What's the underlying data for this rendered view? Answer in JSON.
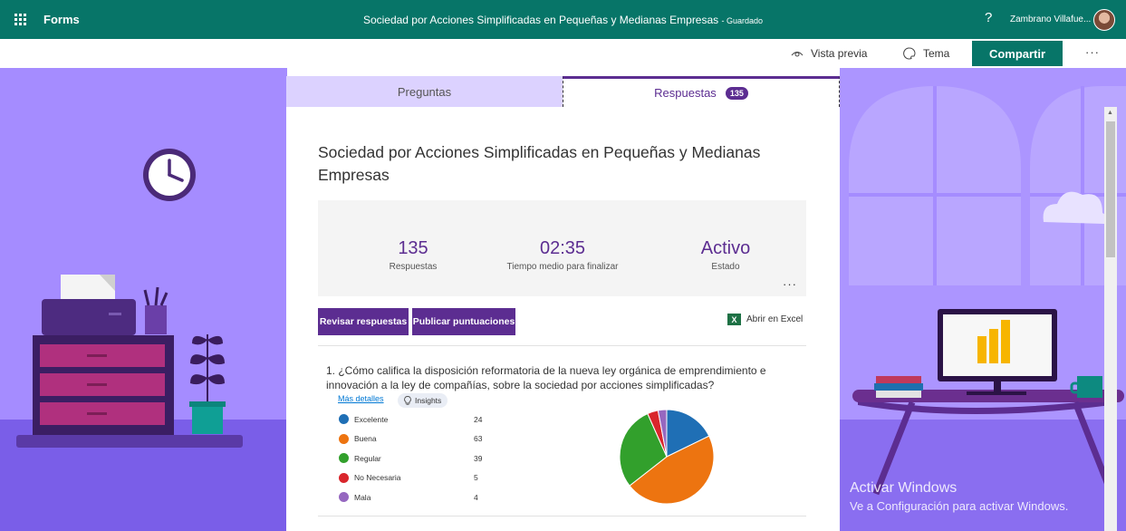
{
  "app": {
    "name": "Forms",
    "doc_title": "Sociedad por Acciones Simplificadas en Pequeñas y Medianas Empresas",
    "saved_status": "- Guardado",
    "help": "?",
    "user_name": "Zambrano Villafue..."
  },
  "toolbar": {
    "preview_label": "Vista previa",
    "theme_label": "Tema",
    "share_label": "Compartir",
    "more_label": "···"
  },
  "tabs": {
    "questions": "Preguntas",
    "responses": "Respuestas",
    "responses_count": "135"
  },
  "form": {
    "title": "Sociedad por Acciones Simplificadas en Pequeñas y Medianas Empresas"
  },
  "summary": {
    "responses_value": "135",
    "responses_label": "Respuestas",
    "avg_time_value": "02:35",
    "avg_time_label": "Tiempo medio para finalizar",
    "status_value": "Activo",
    "status_label": "Estado",
    "more": "···"
  },
  "actions": {
    "review": "Revisar respuestas",
    "publish": "Publicar puntuaciones",
    "excel": "Abrir en Excel"
  },
  "question1": {
    "text": "1.  ¿Cómo califica la disposición reformatoria de la nueva ley orgánica de emprendimiento e innovación a la ley de compañías, sobre la sociedad por acciones simplificadas?",
    "more_details": "Más detalles",
    "insights": "Insights"
  },
  "chart_data": {
    "type": "pie",
    "categories": [
      "Excelente",
      "Buena",
      "Regular",
      "No Necesaria",
      "Mala"
    ],
    "values": [
      24,
      63,
      39,
      5,
      4
    ],
    "colors": [
      "#1f6fb5",
      "#ed7410",
      "#32a02c",
      "#d9262c",
      "#9668c0"
    ]
  },
  "watermark": {
    "line1": "Activar Windows",
    "line2": "Ve a Configuración para activar Windows."
  }
}
